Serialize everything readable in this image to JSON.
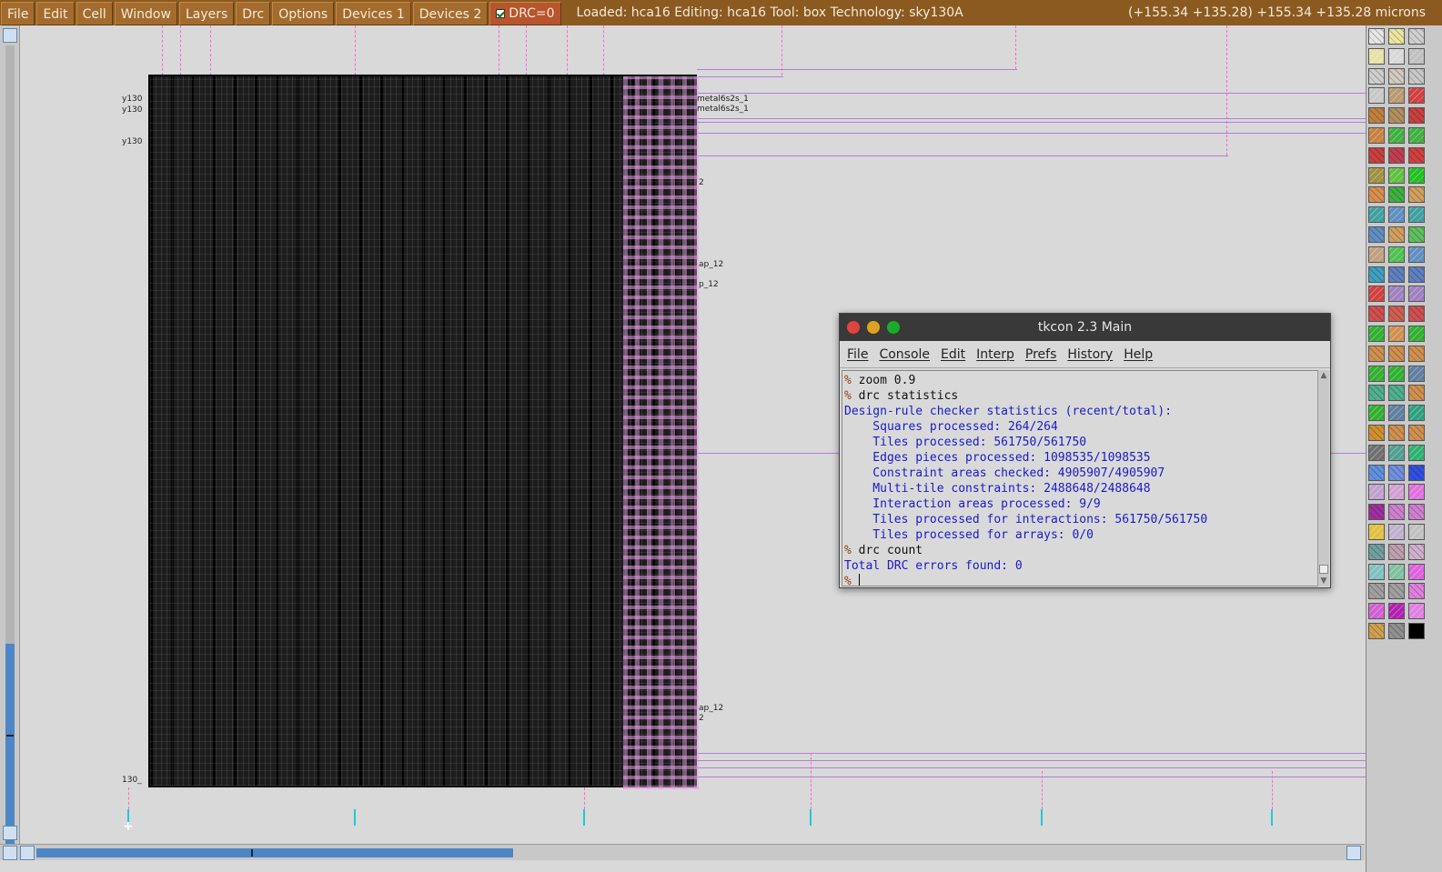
{
  "menubar": {
    "items": [
      "File",
      "Edit",
      "Cell",
      "Window",
      "Layers",
      "Drc",
      "Options",
      "Devices 1",
      "Devices 2"
    ],
    "drc_label": "DRC=0",
    "status": "Loaded: hca16 Editing: hca16 Tool: box  Technology: sky130A",
    "coords": "(+155.34 +135.28) +155.34 +135.28 microns"
  },
  "canvas": {
    "labels": [
      "y130",
      "y130",
      "y130",
      "metal6s2s_1",
      "metal6s2s_1",
      "2",
      "ap_12",
      "p_12",
      "ap_12",
      "2",
      "130_"
    ],
    "cursor": "+"
  },
  "tkcon": {
    "title": "tkcon 2.3 Main",
    "menu": [
      "File",
      "Console",
      "Edit",
      "Interp",
      "Prefs",
      "History",
      "Help"
    ],
    "prompt": "%",
    "lines": [
      {
        "type": "cmd",
        "text": "zoom 0.9"
      },
      {
        "type": "cmd",
        "text": "drc statistics"
      },
      {
        "type": "out",
        "text": "Design-rule checker statistics (recent/total):"
      },
      {
        "type": "out",
        "text": "    Squares processed: 264/264"
      },
      {
        "type": "out",
        "text": "    Tiles processed: 561750/561750"
      },
      {
        "type": "out",
        "text": "    Edges pieces processed: 1098535/1098535"
      },
      {
        "type": "out",
        "text": "    Constraint areas checked: 4905907/4905907"
      },
      {
        "type": "out",
        "text": "    Multi-tile constraints: 2488648/2488648"
      },
      {
        "type": "out",
        "text": "    Interaction areas processed: 9/9"
      },
      {
        "type": "out",
        "text": "    Tiles processed for interactions: 561750/561750"
      },
      {
        "type": "out",
        "text": "    Tiles processed for arrays: 0/0"
      },
      {
        "type": "cmd",
        "text": "drc count"
      },
      {
        "type": "out",
        "text": "Total DRC errors found: 0"
      }
    ]
  },
  "colors": {
    "menubar_bg": "#8b5a20",
    "drc_bg": "#b8542e",
    "scroll_thumb": "#4d86c4",
    "console_output": "#1a1ac8",
    "console_prompt": "#8b4513"
  },
  "palette": {
    "swatches": [
      "#e6e6e6",
      "#ece6a0",
      "#d0d0d0",
      "#e6e2a6",
      "#d8d8d8",
      "#c0c0c0",
      "#cfcfcf",
      "#d0cac0",
      "#c8c8c8",
      "#c8c8c8",
      "#b89a70",
      "#d04040",
      "#c08040",
      "#b09060",
      "#c84040",
      "#c88040",
      "#40b040",
      "#40b040",
      "#c84040",
      "#c04050",
      "#d04040",
      "#a09040",
      "#60c040",
      "#20c020",
      "#d89050",
      "#40b040",
      "#d0a060",
      "#40a0a0",
      "#6090c0",
      "#40a0a0",
      "#6090c0",
      "#d0a060",
      "#60c060",
      "#c0a080",
      "#50c050",
      "#6090c0",
      "#40a0c0",
      "#6080c0",
      "#6080c0",
      "#d04040",
      "#a080c0",
      "#a080c0",
      "#d05050",
      "#d06050",
      "#d05050",
      "#30b030",
      "#d09050",
      "#30b030",
      "#d09050",
      "#d09050",
      "#d09050",
      "#30b030",
      "#30b030",
      "#6080a0",
      "#50b090",
      "#50b090",
      "#d09050",
      "#30b030",
      "#6080a0",
      "#30a080",
      "#d09030",
      "#d09050",
      "#d09050",
      "#707070",
      "#50a090",
      "#30b070",
      "#6090e0",
      "#7090e0",
      "#3050e0",
      "#c0a0d0",
      "#d0a0d0",
      "#e070e0",
      "#a030a0",
      "#d080d0",
      "#d080d0",
      "#e0c040",
      "#c0b0d0",
      "#c0c0c0",
      "#70a0a0",
      "#c0a0b0",
      "#d0b0d0",
      "#80c0c0",
      "#80c0a0",
      "#e060e0",
      "#a0a0a0",
      "#a0a0a0",
      "#e080e0",
      "#d060d0",
      "#b020b0",
      "#e080e0",
      "#d0a050",
      "#909090",
      "#000000"
    ]
  }
}
